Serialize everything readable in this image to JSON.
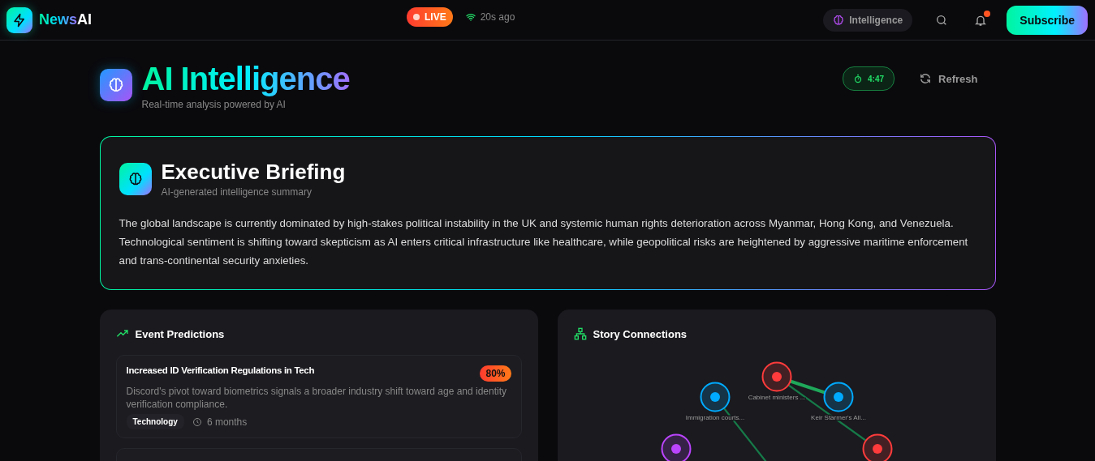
{
  "brand": {
    "part1": "News",
    "part2": "AI"
  },
  "live": {
    "label": "LIVE",
    "on": true
  },
  "updated": "20s ago",
  "nav": {
    "intelligence": "Intelligence",
    "notifications_unread": true,
    "subscribe": "Subscribe"
  },
  "page": {
    "title": "AI Intelligence",
    "subtitle": "Real-time analysis powered by AI",
    "timer": "4:47",
    "refresh": "Refresh"
  },
  "briefing": {
    "title": "Executive Briefing",
    "subtitle": "AI-generated intelligence summary",
    "text": "The global landscape is currently dominated by high-stakes political instability in the UK and systemic human rights deterioration across Myanmar, Hong Kong, and Venezuela. Technological sentiment is shifting toward skepticism as AI enters critical infrastructure like healthcare, while geopolitical risks are heightened by aggressive maritime enforcement and trans-continental security anxieties."
  },
  "predictions": {
    "title": "Event Predictions",
    "items": [
      {
        "title": "Increased ID Verification Regulations in Tech",
        "probability": "80%",
        "description": "Discord's pivot toward biometrics signals a broader industry shift toward age and identity verification compliance.",
        "category": "Technology",
        "timeframe": "6 months"
      }
    ]
  },
  "connections": {
    "title": "Story Connections",
    "nodes": [
      {
        "label": "Cabinet ministers ...",
        "color": "#ff3b3b"
      },
      {
        "label": "Immigration courts...",
        "color": "#00aaff"
      },
      {
        "label": "Keir Starmer's All...",
        "color": "#00aaff"
      },
      {
        "color": "#bb44ff"
      },
      {
        "color": "#ff3b3b"
      }
    ],
    "edges": [
      {
        "strong": true
      },
      {
        "strong": false
      },
      {
        "strong": false
      }
    ]
  }
}
